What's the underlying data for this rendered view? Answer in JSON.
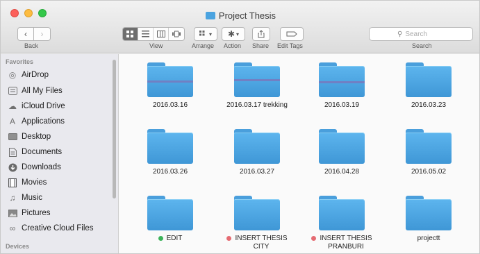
{
  "window": {
    "title": "Project Thesis"
  },
  "toolbar": {
    "back_label": "Back",
    "view_label": "View",
    "arrange_label": "Arrange",
    "action_label": "Action",
    "share_label": "Share",
    "edit_tags_label": "Edit Tags",
    "search_label": "Search",
    "search_placeholder": "Search"
  },
  "sidebar": {
    "favorites_heading": "Favorites",
    "devices_heading": "Devices",
    "items": [
      {
        "label": "AirDrop",
        "icon": "airdrop-icon"
      },
      {
        "label": "All My Files",
        "icon": "all-files-icon"
      },
      {
        "label": "iCloud Drive",
        "icon": "cloud-icon"
      },
      {
        "label": "Applications",
        "icon": "applications-icon"
      },
      {
        "label": "Desktop",
        "icon": "desktop-icon"
      },
      {
        "label": "Documents",
        "icon": "documents-icon"
      },
      {
        "label": "Downloads",
        "icon": "downloads-icon"
      },
      {
        "label": "Movies",
        "icon": "movies-icon"
      },
      {
        "label": "Music",
        "icon": "music-icon"
      },
      {
        "label": "Pictures",
        "icon": "pictures-icon"
      },
      {
        "label": "Creative Cloud Files",
        "icon": "creative-cloud-icon"
      }
    ]
  },
  "folders": [
    {
      "name": "2016.03.16",
      "tag": ""
    },
    {
      "name": "2016.03.17 trekking",
      "tag": ""
    },
    {
      "name": "2016.03.19",
      "tag": ""
    },
    {
      "name": "2016.03.23",
      "tag": ""
    },
    {
      "name": "2016.03.26",
      "tag": ""
    },
    {
      "name": "2016.03.27",
      "tag": ""
    },
    {
      "name": "2016.04.28",
      "tag": ""
    },
    {
      "name": "2016.05.02",
      "tag": ""
    },
    {
      "name": "EDIT",
      "tag": "#3cb35a"
    },
    {
      "name": "INSERT THESIS\nCITY",
      "tag": "#e56b72"
    },
    {
      "name": "INSERT THESIS\nPRANBURI",
      "tag": "#e56b72"
    },
    {
      "name": "projectt",
      "tag": ""
    }
  ],
  "colors": {
    "folder_blue": "#4aa3e0",
    "tag_green": "#3cb35a",
    "tag_red": "#e56b72"
  }
}
